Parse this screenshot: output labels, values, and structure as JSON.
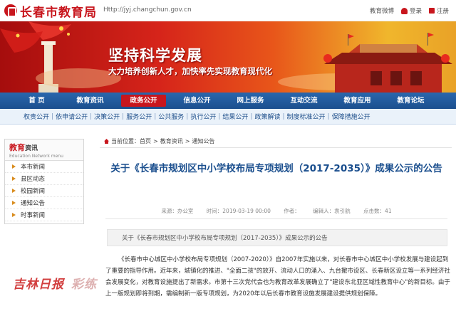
{
  "header": {
    "site_name": "长春市教育局",
    "url": "Http://jyj.changchun.gov.cn",
    "weibo": "教育微博",
    "login": "登录",
    "register": "注册"
  },
  "banner": {
    "title": "坚持科学发展",
    "subtitle": "大力培养创新人才，加快率先实现教育现代化"
  },
  "main_nav": [
    "首 页",
    "教育资讯",
    "政务公开",
    "信息公开",
    "网上服务",
    "互动交流",
    "教育应用",
    "教育论坛"
  ],
  "main_nav_active": "政务公开",
  "sub_nav": [
    "权责公开",
    "依申请公开",
    "决策公开",
    "服务公开",
    "公共服务",
    "执行公开",
    "结果公开",
    "政策解读",
    "制度标准公开",
    "保障措施公开"
  ],
  "sidebar": {
    "title_main": "教育",
    "title_small": "资讯",
    "title_en": "Education Network menu",
    "items": [
      "本市新闻",
      "县区动态",
      "校园新闻",
      "通知公告",
      "时事新闻"
    ]
  },
  "breadcrumb": {
    "prefix": "当前位置：",
    "items": [
      "首页",
      "教育资讯",
      "通知公告"
    ],
    "sep": ">"
  },
  "article": {
    "title": "关于《长春市规划区中小学校布局专项规划（2017-2035）》成果公示的公告",
    "source": "来源：办公室",
    "time": "时间：2019-03-19 00:00",
    "author": "作者：",
    "editor": "编辑人：袁引航",
    "views": "点击数：41",
    "summary": "关于《长春市规划区中小学校布局专项规划（2017-2035）》成果公示的公告",
    "body": "《长春市中心城区中小学校布局专项规划（2007-2020）》自2007年实施以来，对长春市中心城区中小学校发展与建设起到了重要的指导作用。近年来，城镇化的推进、\"全面二孩\"的放开、流动人口的涌入、九台撤市设区、长春新区设立等一系列经济社会发展变化，对教育设施提出了新需求。市第十三次党代会也为教育改革发展确立了\"建设东北亚区域性教育中心\"的新目标。由于上一版规划即将到期，需编制新一版专项规划，为2020年以后长春市教育设施发展建设提供规划保障。"
  },
  "watermark": {
    "left": "吉林日报",
    "right": "彩练"
  },
  "colors": {
    "brand_red": "#c8161d",
    "nav_blue": "#1b4f8e",
    "title_blue": "#1b4f8e"
  }
}
